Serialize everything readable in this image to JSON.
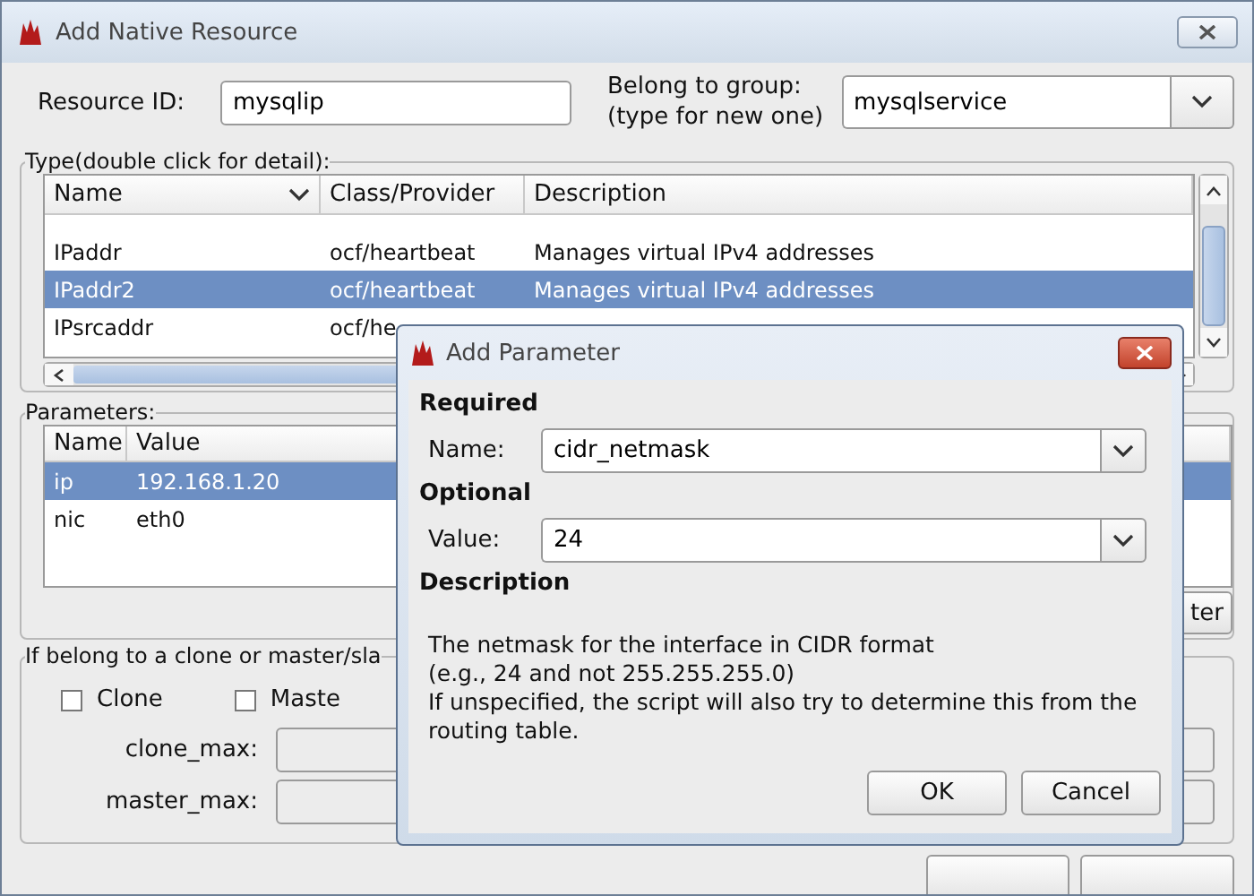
{
  "window": {
    "title": "Add Native Resource"
  },
  "resource_id": {
    "label": "Resource ID:",
    "value": "mysqlip"
  },
  "group": {
    "label_lines": [
      "Belong to group:",
      "(type for new one)"
    ],
    "value": "mysqlservice"
  },
  "type_section": {
    "legend": "Type(double click for detail):",
    "columns": [
      "Name",
      "Class/Provider",
      "Description"
    ],
    "rows": [
      {
        "cells": [
          "IPaddr",
          "ocf/heartbeat",
          "Manages virtual IPv4 addresses"
        ],
        "selected": false
      },
      {
        "cells": [
          "IPaddr2",
          "ocf/heartbeat",
          "Manages virtual IPv4 addresses"
        ],
        "selected": true
      },
      {
        "cells": [
          "IPsrcaddr",
          "ocf/he"
        ],
        "selected": false
      }
    ]
  },
  "parameters": {
    "legend": "Parameters:",
    "columns": [
      "Name",
      "Value"
    ],
    "rows": [
      {
        "cells": [
          "ip",
          "192.168.1.20"
        ],
        "selected": true
      },
      {
        "cells": [
          "nic",
          "eth0"
        ],
        "selected": false
      }
    ],
    "button": "ter"
  },
  "clone_section": {
    "legend": "If belong to a clone or master/sla",
    "checkboxes": [
      {
        "label": "Clone",
        "checked": false
      },
      {
        "label": "Maste",
        "checked": false
      }
    ],
    "fields": [
      {
        "label": "clone_max:"
      },
      {
        "label": "master_max:"
      }
    ]
  },
  "dialog": {
    "title": "Add Parameter",
    "required_heading": "Required",
    "name": {
      "label": "Name:",
      "value": "cidr_netmask"
    },
    "optional_heading": "Optional",
    "value": {
      "label": "Value:",
      "value": "24"
    },
    "description_heading": "Description",
    "description": "The netmask for the interface in CIDR format\n(e.g., 24 and not 255.255.255.0)\nIf unspecified, the script will also try to determine this from the\nrouting table.",
    "buttons": [
      "OK",
      "Cancel"
    ]
  }
}
